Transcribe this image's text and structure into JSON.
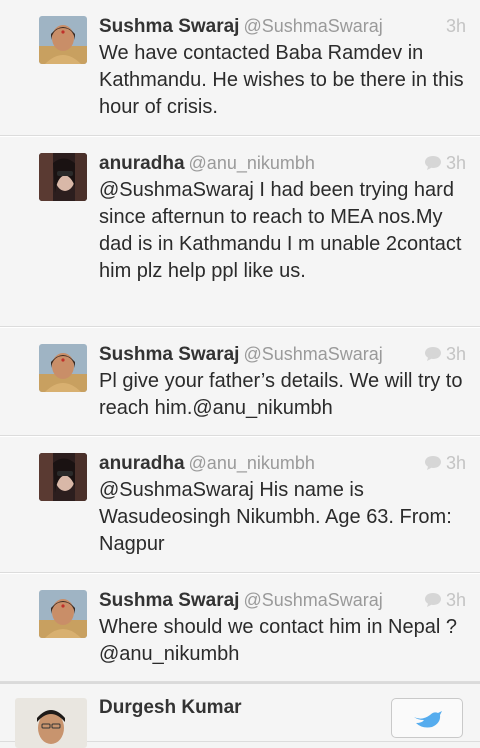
{
  "tweets": [
    {
      "name": "Sushma Swaraj",
      "handle": "@SushmaSwaraj",
      "time": "3h",
      "text": "We have contacted Baba Ramdev in Kathmandu. He wishes to be there in this hour of crisis.",
      "avatar": "sushma-avatar",
      "show_reply_icon": false
    },
    {
      "name": "anuradha",
      "handle": "@anu_nikumbh",
      "time": "3h",
      "text": "@SushmaSwaraj I had been trying hard since afternun to reach to MEA nos.My dad is in Kathmandu I m unable 2contact him plz help ppl like us.",
      "avatar": "anuradha-avatar",
      "show_reply_icon": true
    },
    {
      "name": "Sushma Swaraj",
      "handle": "@SushmaSwaraj",
      "time": "3h",
      "text": "Pl give your father’s details. We will try to reach him.@anu_nikumbh",
      "avatar": "sushma-avatar",
      "show_reply_icon": true
    },
    {
      "name": "anuradha",
      "handle": "@anu_nikumbh",
      "time": "3h",
      "text": "@SushmaSwaraj His name is Wasudeosingh Nikumbh. Age 63. From: Nagpur",
      "avatar": "anuradha-avatar",
      "show_reply_icon": true
    },
    {
      "name": "Sushma Swaraj",
      "handle": "@SushmaSwaraj",
      "time": "3h",
      "text": "Where should we contact him in Nepal ? @anu_nikumbh",
      "avatar": "sushma-avatar",
      "show_reply_icon": true
    }
  ],
  "suggestion": {
    "name": "Durgesh Kumar",
    "button_icon": "follow-bird-icon"
  },
  "colors": {
    "background": "#f5f5f5",
    "divider": "#dcdcdc",
    "meta_gray": "#c4c4c4",
    "handle_gray": "#9a9a9a"
  }
}
